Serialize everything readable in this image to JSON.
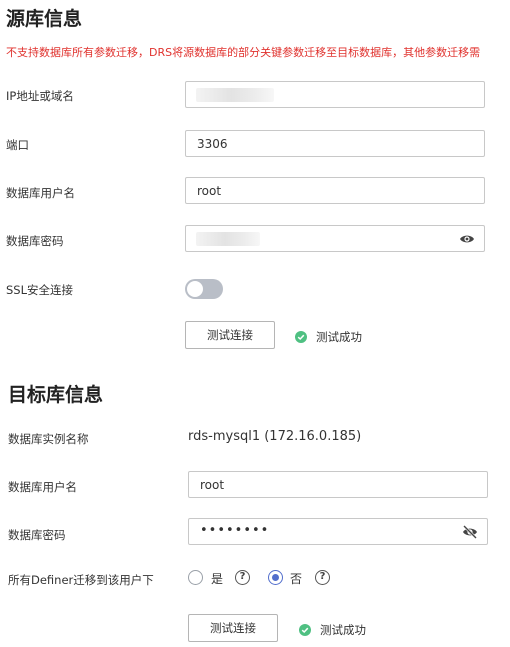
{
  "source": {
    "title": "源库信息",
    "warning": "不支持数据库所有参数迁移，DRS将源数据库的部分关键参数迁移至目标数据库，其他参数迁移需",
    "fields": {
      "ip": {
        "label": "IP地址或域名",
        "value": ""
      },
      "port": {
        "label": "端口",
        "value": "3306"
      },
      "username": {
        "label": "数据库用户名",
        "value": "root"
      },
      "password": {
        "label": "数据库密码",
        "value": ""
      },
      "ssl": {
        "label": "SSL安全连接",
        "enabled": false
      }
    },
    "test_button": "测试连接",
    "test_result": "测试成功"
  },
  "target": {
    "title": "目标库信息",
    "instance": {
      "label": "数据库实例名称",
      "value": "rds-mysql1 (172.16.0.185)"
    },
    "username": {
      "label": "数据库用户名",
      "value": "root"
    },
    "password": {
      "label": "数据库密码",
      "masked": "••••••••"
    },
    "definer": {
      "label": "所有Definer迁移到该用户下",
      "options": [
        "是",
        "否"
      ],
      "selected": "否"
    },
    "test_button": "测试连接",
    "test_result": "测试成功"
  },
  "colors": {
    "warning": "#e0322e",
    "success": "#4fc082",
    "accent": "#526ecc",
    "toggle_off": "#b9bec7"
  },
  "icons": [
    "eye-icon",
    "eye-slash-icon",
    "check-circle-icon",
    "help-icon"
  ]
}
